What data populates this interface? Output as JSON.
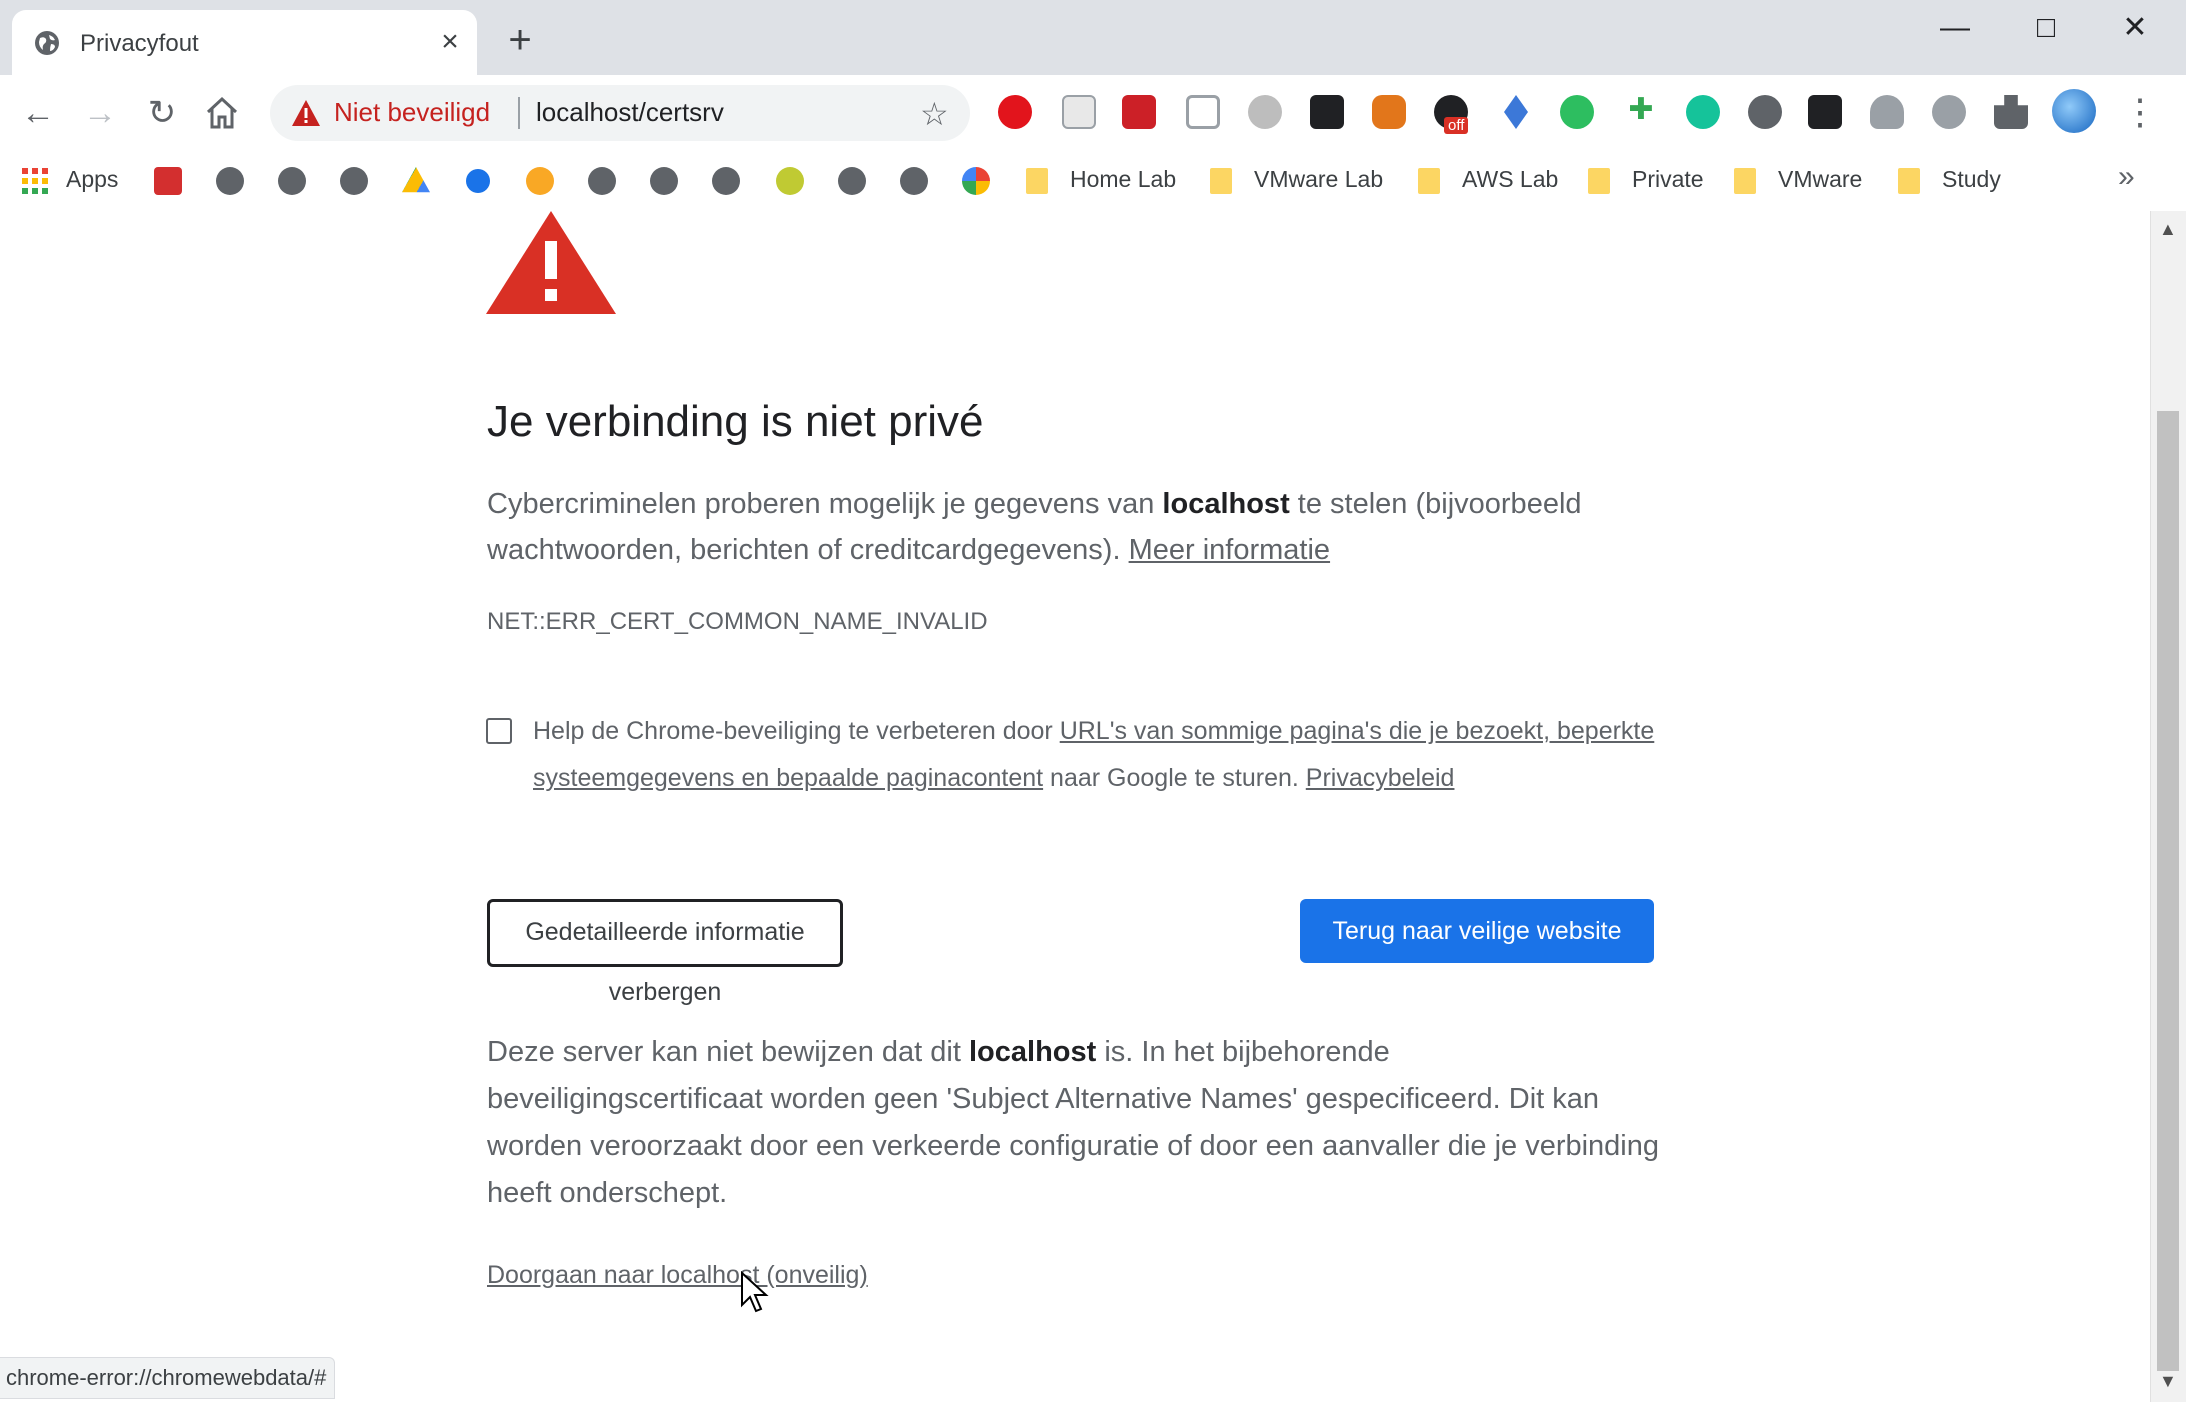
{
  "tab": {
    "title": "Privacyfout"
  },
  "window_controls": {
    "minimize": "—",
    "maximize": "□",
    "close": "✕"
  },
  "omnibox": {
    "security_label": "Niet beveiligd",
    "url": "localhost/certsrv",
    "security_color": "#c5221f"
  },
  "extensions": {
    "badge_off": "off",
    "icons": [
      "opera-icon",
      "grid-icon",
      "lastpass-icon",
      "camera-icon",
      "bug-icon",
      "mask-icon",
      "metamask-icon",
      "cookie-off-icon",
      "ethereum-icon",
      "evernote-icon",
      "plus-icon",
      "grammarly-icon",
      "moon-icon",
      "black-box-icon",
      "hand-icon",
      "c-icon",
      "puzzle-icon",
      "profile-avatar"
    ]
  },
  "bookmarks": {
    "apps": "Apps",
    "folders": [
      "Home Lab",
      "VMware Lab",
      "AWS Lab",
      "Private",
      "VMware",
      "Study"
    ],
    "more": "»"
  },
  "page": {
    "heading": "Je verbinding is niet privé",
    "para1_a": "Cybercriminelen proberen mogelijk je gegevens van ",
    "para1_host": "localhost",
    "para1_b": " te stelen (bijvoorbeeld wachtwoorden, berichten of creditcardgegevens). ",
    "more_info": "Meer informatie",
    "error_code": "NET::ERR_CERT_COMMON_NAME_INVALID",
    "checkbox_a": "Help de Chrome-beveiliging te verbeteren door ",
    "checkbox_link": "URL's van sommige pagina's die je bezoekt, beperkte systeemgegevens en bepaalde paginacontent",
    "checkbox_b": " naar Google te sturen. ",
    "privacy_link": "Privacybeleid",
    "details_button": "Gedetailleerde informatie verbergen",
    "back_button": "Terug naar veilige website",
    "para2_a": "Deze server kan niet bewijzen dat dit ",
    "para2_host": "localhost",
    "para2_b": " is. In het bijbehorende beveiligingscertificaat worden geen 'Subject Alternative Names' gespecificeerd. Dit kan worden veroorzaakt door een verkeerde configuratie of door een aanvaller die je verbinding heeft onderschept.",
    "proceed_link": "Doorgaan naar localhost (onveilig)",
    "accent_color": "#1a73e8"
  },
  "status_bar": {
    "text": "chrome-error://chromewebdata/#"
  }
}
